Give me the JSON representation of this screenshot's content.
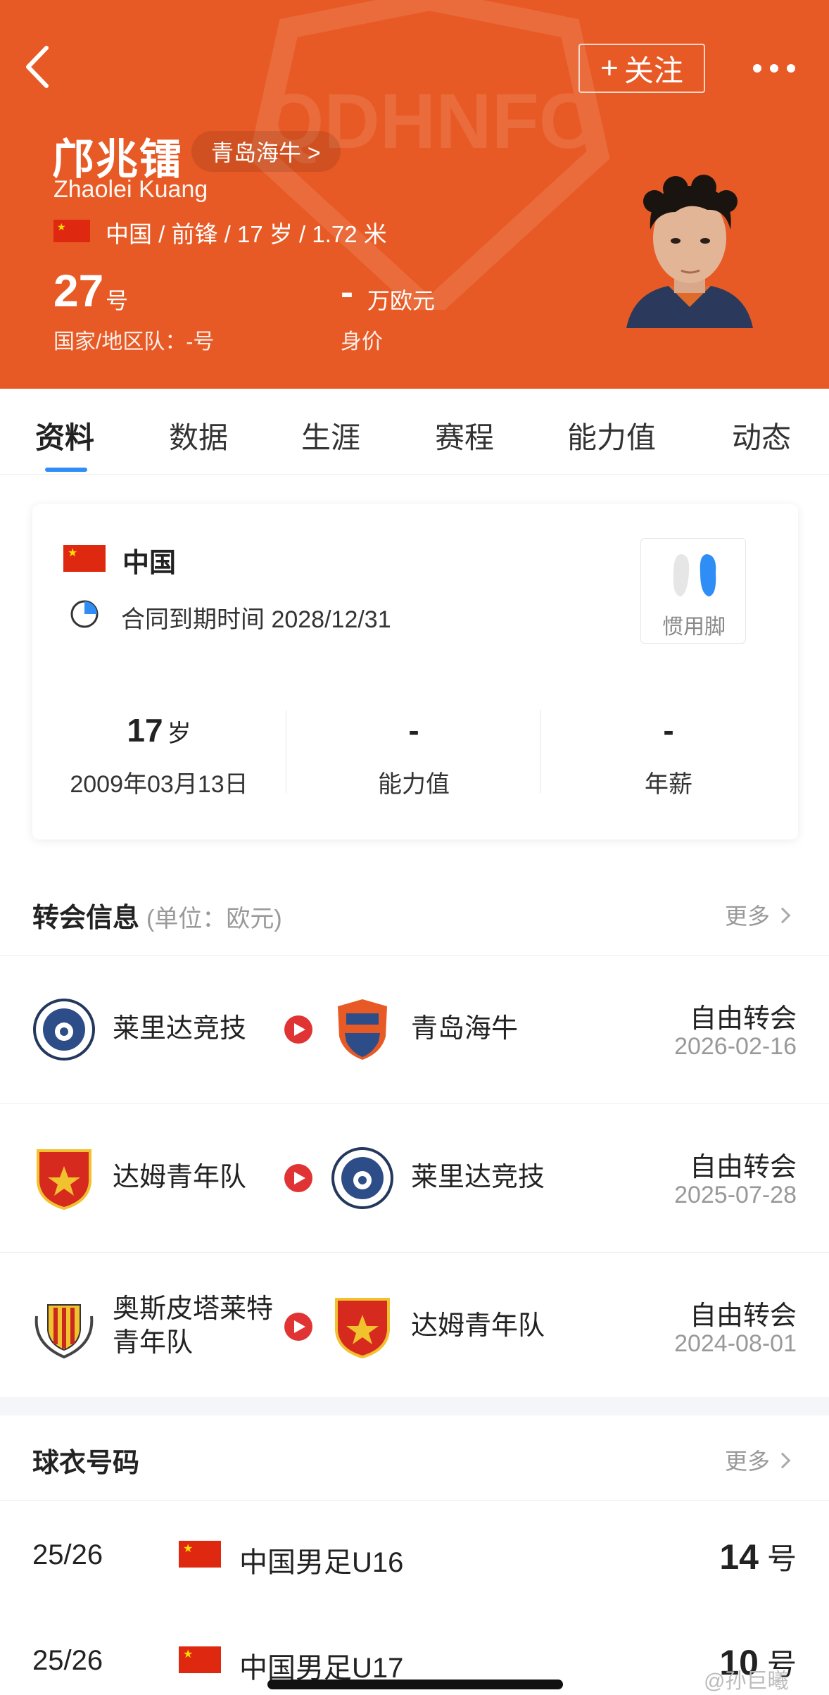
{
  "header": {
    "follow_label": "关注",
    "name_cn": "邝兆镭",
    "club": "青岛海牛 >",
    "name_en": "Zhaolei Kuang",
    "meta": "中国 / 前锋 / 17 岁 / 1.72 米",
    "shirt_number": "27",
    "shirt_unit": "号",
    "national_team": "国家/地区队：-号",
    "market_value": "-",
    "market_value_unit": "万欧元",
    "market_value_label": "身价",
    "watermark_text": "QDHNFC",
    "accent_color": "#e85a25"
  },
  "tabs": [
    "资料",
    "数据",
    "生涯",
    "赛程",
    "能力值",
    "动态"
  ],
  "active_tab": 0,
  "info": {
    "country": "中国",
    "contract": "合同到期时间 2028/12/31",
    "foot_label": "惯用脚",
    "stats": [
      {
        "value": "17",
        "unit": "岁",
        "label": "2009年03月13日"
      },
      {
        "value": "-",
        "unit": "",
        "label": "能力值"
      },
      {
        "value": "-",
        "unit": "",
        "label": "年薪"
      }
    ]
  },
  "transfers": {
    "title": "转会信息",
    "subtitle": "(单位：欧元)",
    "more": "更多",
    "rows": [
      {
        "from": "莱里达竞技",
        "to": "青岛海牛",
        "type": "自由转会",
        "date": "2026-02-16"
      },
      {
        "from": "达姆青年队",
        "to": "莱里达竞技",
        "type": "自由转会",
        "date": "2025-07-28"
      },
      {
        "from": "奥斯皮塔莱特青年队",
        "to": "达姆青年队",
        "type": "自由转会",
        "date": "2024-08-01"
      }
    ]
  },
  "shirts": {
    "title": "球衣号码",
    "more": "更多",
    "rows": [
      {
        "season": "25/26",
        "team": "中国男足U16",
        "number": "14",
        "unit": "号"
      },
      {
        "season": "25/26",
        "team": "中国男足U17",
        "number": "10",
        "unit": "号"
      }
    ]
  },
  "watermark": "@孙巨曦",
  "colors": {
    "flag_red": "#de2910",
    "flag_star": "#ffde00",
    "tab_accent": "#2f8ef5",
    "transfer_arrow": "#e03434"
  }
}
